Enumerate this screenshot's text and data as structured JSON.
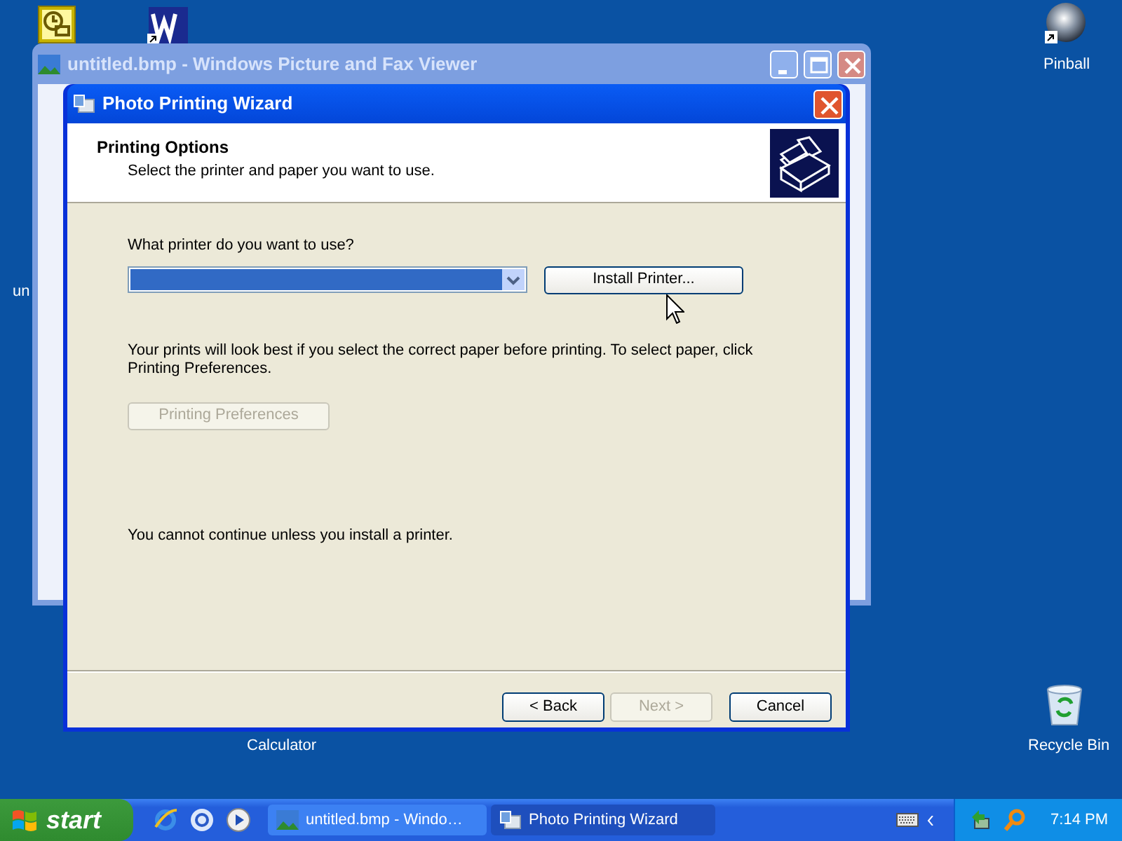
{
  "desktop_icons": [
    {
      "kind": "clock-doc"
    },
    {
      "kind": "word"
    },
    {
      "kind": "ball",
      "label": "Pinball"
    },
    {
      "kind": "none",
      "label": "Calculator"
    },
    {
      "kind": "bin",
      "label": "Recycle Bin"
    }
  ],
  "desktop_label_fragments": [
    "un"
  ],
  "back_window": {
    "title": "untitled.bmp - Windows Picture and Fax Viewer"
  },
  "wizard": {
    "title": "Photo Printing Wizard",
    "header_title": "Printing Options",
    "header_subtitle": "Select the printer and paper you want to use.",
    "printer_prompt": "What printer do you want to use?",
    "install_button": "Install Printer...",
    "paper_hint": "Your prints will look best if you select the correct paper before printing. To select paper, click Printing Preferences.",
    "preferences_button": {
      "label": "Printing Preferences",
      "disabled": true
    },
    "warning": "You cannot continue unless you install a printer.",
    "buttons": [
      {
        "label": "< Back",
        "disabled": false
      },
      {
        "label": "Next >",
        "disabled": true
      },
      {
        "label": "Cancel",
        "disabled": false
      }
    ]
  },
  "taskbar": {
    "start": "start",
    "tasks": [
      {
        "label": "untitled.bmp - Windo…",
        "selected": false
      },
      {
        "label": "Photo Printing Wizard",
        "selected": true
      }
    ],
    "clock": "7:14 PM"
  }
}
